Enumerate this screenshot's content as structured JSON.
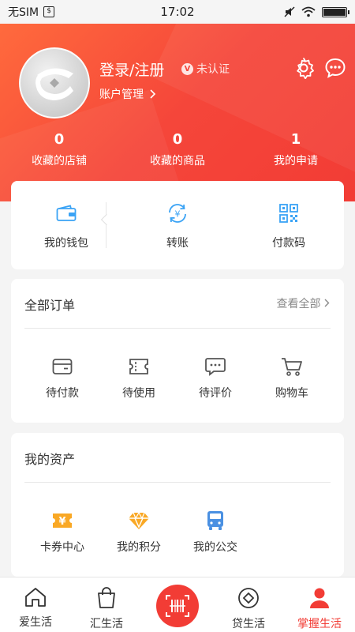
{
  "status_bar": {
    "carrier": "无SIM",
    "sim_icon": "sim-icon",
    "time": "17:02",
    "icons": [
      "mute-icon",
      "wifi-icon",
      "battery-icon"
    ]
  },
  "profile": {
    "login_label": "登录/注册",
    "verify_label": "未认证",
    "verify_badge_letter": "V",
    "account_manage_label": "账户管理",
    "icons": [
      "settings-gear-icon",
      "message-bubble-icon"
    ]
  },
  "stats": [
    {
      "value": "0",
      "label": "收藏的店铺"
    },
    {
      "value": "0",
      "label": "收藏的商品"
    },
    {
      "value": "1",
      "label": "我的申请"
    }
  ],
  "wallet": [
    {
      "label": "我的钱包",
      "icon": "wallet-icon"
    },
    {
      "label": "转账",
      "icon": "transfer-yuan-icon"
    },
    {
      "label": "付款码",
      "icon": "qr-code-icon"
    }
  ],
  "orders": {
    "title": "全部订单",
    "view_all": "查看全部",
    "items": [
      {
        "label": "待付款",
        "icon": "pending-payment-icon"
      },
      {
        "label": "待使用",
        "icon": "ticket-icon"
      },
      {
        "label": "待评价",
        "icon": "comment-icon"
      },
      {
        "label": "购物车",
        "icon": "cart-icon"
      }
    ]
  },
  "assets": {
    "title": "我的资产",
    "items": [
      {
        "label": "卡券中心",
        "icon": "coupon-icon"
      },
      {
        "label": "我的积分",
        "icon": "diamond-icon"
      },
      {
        "label": "我的公交",
        "icon": "bus-icon"
      }
    ]
  },
  "bottom_nav": {
    "items": [
      {
        "label": "爱生活",
        "icon": "home-icon"
      },
      {
        "label": "汇生活",
        "icon": "shopping-bag-icon"
      },
      {
        "label": "贷生活",
        "icon": "loan-icon"
      },
      {
        "label": "掌握生活",
        "icon": "user-icon"
      }
    ],
    "scan_icon": "scan-barcode-icon",
    "active_color": "#f23c35"
  },
  "colors": {
    "brand_red": "#f23c35",
    "header_gradient_start": "#ff6a3d",
    "wallet_blue": "#3aa3f5",
    "asset_orange": "#f9a825",
    "bus_blue": "#4a90e2"
  }
}
